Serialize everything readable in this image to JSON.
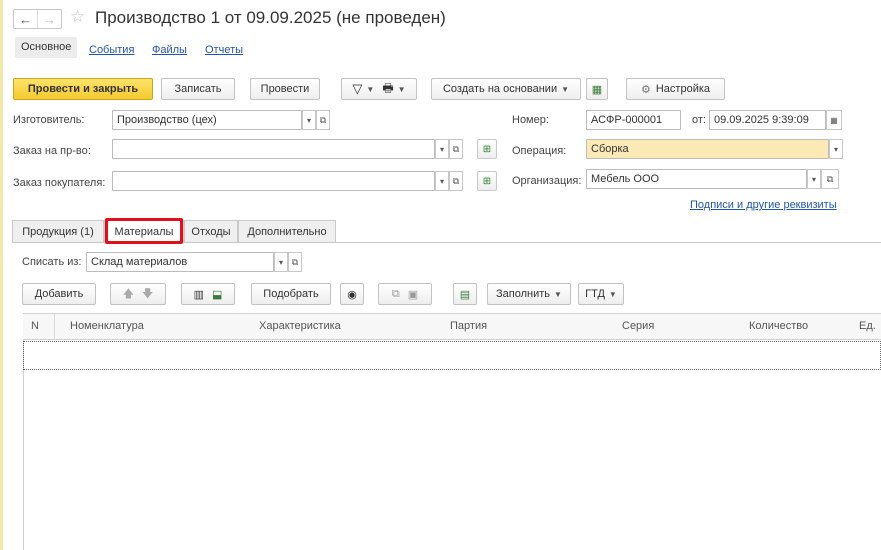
{
  "header": {
    "back": "←",
    "forward": "→",
    "star": "☆",
    "title": "Производство 1 от 09.09.2025 (не проведен)"
  },
  "sections": [
    "Основное",
    "События",
    "Файлы",
    "Отчеты"
  ],
  "toolbar": {
    "post_close": "Провести и закрыть",
    "save": "Записать",
    "post": "Провести",
    "filter_icon": "▽",
    "print_icon": "🖶",
    "create_based": "Создать на основании",
    "report_icon": "▦",
    "settings_icon": "⚙",
    "settings": "Настройка"
  },
  "form": {
    "manufacturer_label": "Изготовитель:",
    "manufacturer_value": "Производство (цех)",
    "order_label": "Заказ на пр-во:",
    "order_value": "",
    "customer_order_label": "Заказ покупателя:",
    "customer_order_value": "",
    "number_label": "Номер:",
    "number_value": "АСФР-000001",
    "date_label": "от:",
    "date_value": "09.09.2025  9:39:09",
    "operation_label": "Операция:",
    "operation_value": "Сборка",
    "org_label": "Организация:",
    "org_value": "Мебель ООО",
    "signatures_link": "Подписи и другие реквизиты"
  },
  "tabs": [
    "Продукция (1)",
    "Материалы",
    "Отходы",
    "Дополнительно"
  ],
  "materials": {
    "write_off_label": "Списать из:",
    "write_off_value": "Склад материалов",
    "add": "Добавить",
    "pick": "Подобрать",
    "fill": "Заполнить",
    "gtd": "ГТД",
    "columns": [
      "N",
      "Номенклатура",
      "Характеристика",
      "Партия",
      "Серия",
      "Количество",
      "Ед."
    ]
  },
  "colors": {
    "accent_yellow": "#f4c930",
    "operation_field": "#fbe9b6",
    "highlight_red": "#e0101a",
    "link_blue": "#2255aa"
  }
}
